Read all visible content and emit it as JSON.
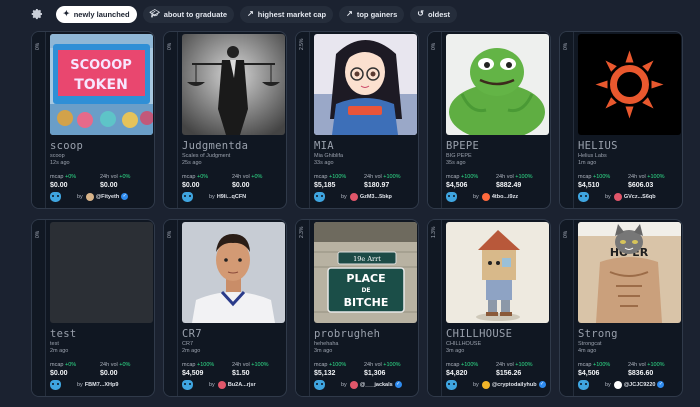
{
  "filters": [
    {
      "label": "newly launched",
      "icon": "sparkle-icon",
      "active": true
    },
    {
      "label": "about to graduate",
      "icon": "graduation-cap-icon",
      "active": false
    },
    {
      "label": "highest market cap",
      "icon": "trend-up-icon",
      "active": false
    },
    {
      "label": "top gainers",
      "icon": "arrow-up-right-icon",
      "active": false
    },
    {
      "label": "oldest",
      "icon": "history-icon",
      "active": false
    }
  ],
  "card_labels": {
    "mcap": "mcap",
    "vol": "24h vol",
    "by": "by"
  },
  "cards": [
    {
      "progress": "0%",
      "name": "scoop",
      "subtitle": "scoop",
      "age": "12s ago",
      "mcap_change": "+0%",
      "mcap": "$0.00",
      "vol_change": "+0%",
      "vol": "$0.00",
      "creator": "@Fityeth",
      "verified": true,
      "avatar_color": "#d8b48a"
    },
    {
      "progress": "0%",
      "name": "Judgmentda",
      "subtitle": "Scales of Judgment",
      "age": "25s ago",
      "mcap_change": "+0%",
      "mcap": "$0.00",
      "vol_change": "+0%",
      "vol": "$0.00",
      "creator": "H9li...qCFN",
      "verified": false,
      "avatar_color": ""
    },
    {
      "progress": "2.5%",
      "name": "MIA",
      "subtitle": "Mia Ghiblifa",
      "age": "33s ago",
      "mcap_change": "+100%",
      "mcap": "$5,185",
      "vol_change": "+100%",
      "vol": "$180.97",
      "creator": "GzM3...5bkp",
      "verified": false,
      "avatar_color": "#e0566a"
    },
    {
      "progress": "0%",
      "name": "BPEPE",
      "subtitle": "BIG PEPE",
      "age": "35s ago",
      "mcap_change": "+100%",
      "mcap": "$4,506",
      "vol_change": "+100%",
      "vol": "$882.49",
      "creator": "4tbo...i9zz",
      "verified": false,
      "avatar_color": "#ff6a3d"
    },
    {
      "progress": "0%",
      "name": "HELIUS",
      "subtitle": "Helius Labs",
      "age": "1m ago",
      "mcap_change": "+100%",
      "mcap": "$4,510",
      "vol_change": "+100%",
      "vol": "$606.03",
      "creator": "GVcz...S6qb",
      "verified": false,
      "avatar_color": "#e0566a"
    },
    {
      "progress": "0%",
      "name": "test",
      "subtitle": "test",
      "age": "2m ago",
      "mcap_change": "+0%",
      "mcap": "$0.00",
      "vol_change": "+0%",
      "vol": "$0.00",
      "creator": "FBM7...XHp9",
      "verified": false,
      "avatar_color": ""
    },
    {
      "progress": "0%",
      "name": "CR7",
      "subtitle": "CR7",
      "age": "2m ago",
      "mcap_change": "+100%",
      "mcap": "$4,509",
      "vol_change": "+100%",
      "vol": "$1.50",
      "creator": "Bu2A...rjsr",
      "verified": false,
      "avatar_color": "#e0566a"
    },
    {
      "progress": "2.3%",
      "name": "probrugheh",
      "subtitle": "hehehaha",
      "age": "3m ago",
      "mcap_change": "+100%",
      "mcap": "$5,132",
      "vol_change": "+100%",
      "vol": "$1,306",
      "creator": "@___jackals",
      "verified": true,
      "avatar_color": "#e0566a"
    },
    {
      "progress": "1.3%",
      "name": "CHILLHOUSE",
      "subtitle": "CHILLHOUSE",
      "age": "3m ago",
      "mcap_change": "+100%",
      "mcap": "$4,820",
      "vol_change": "+100%",
      "vol": "$156.26",
      "creator": "@cryptodailyhub",
      "verified": true,
      "avatar_color": "#f0b429"
    },
    {
      "progress": "0%",
      "name": "Strong",
      "subtitle": "Strongcat",
      "age": "4m ago",
      "mcap_change": "+100%",
      "mcap": "$4,506",
      "vol_change": "+100%",
      "vol": "$836.60",
      "creator": "@JCJC9220",
      "verified": true,
      "avatar_color": "#ffffff"
    }
  ],
  "images": [
    {
      "sign_line1": "SCOOOP",
      "sign_line2": "TOKEN"
    },
    {},
    {},
    {},
    {},
    {},
    {},
    {
      "sign_top": "19e Arrt",
      "sign_line1": "PLACE",
      "sign_line2": "DE",
      "sign_line3": "BITCHE"
    },
    {},
    {
      "sign": "HO  ER"
    }
  ]
}
